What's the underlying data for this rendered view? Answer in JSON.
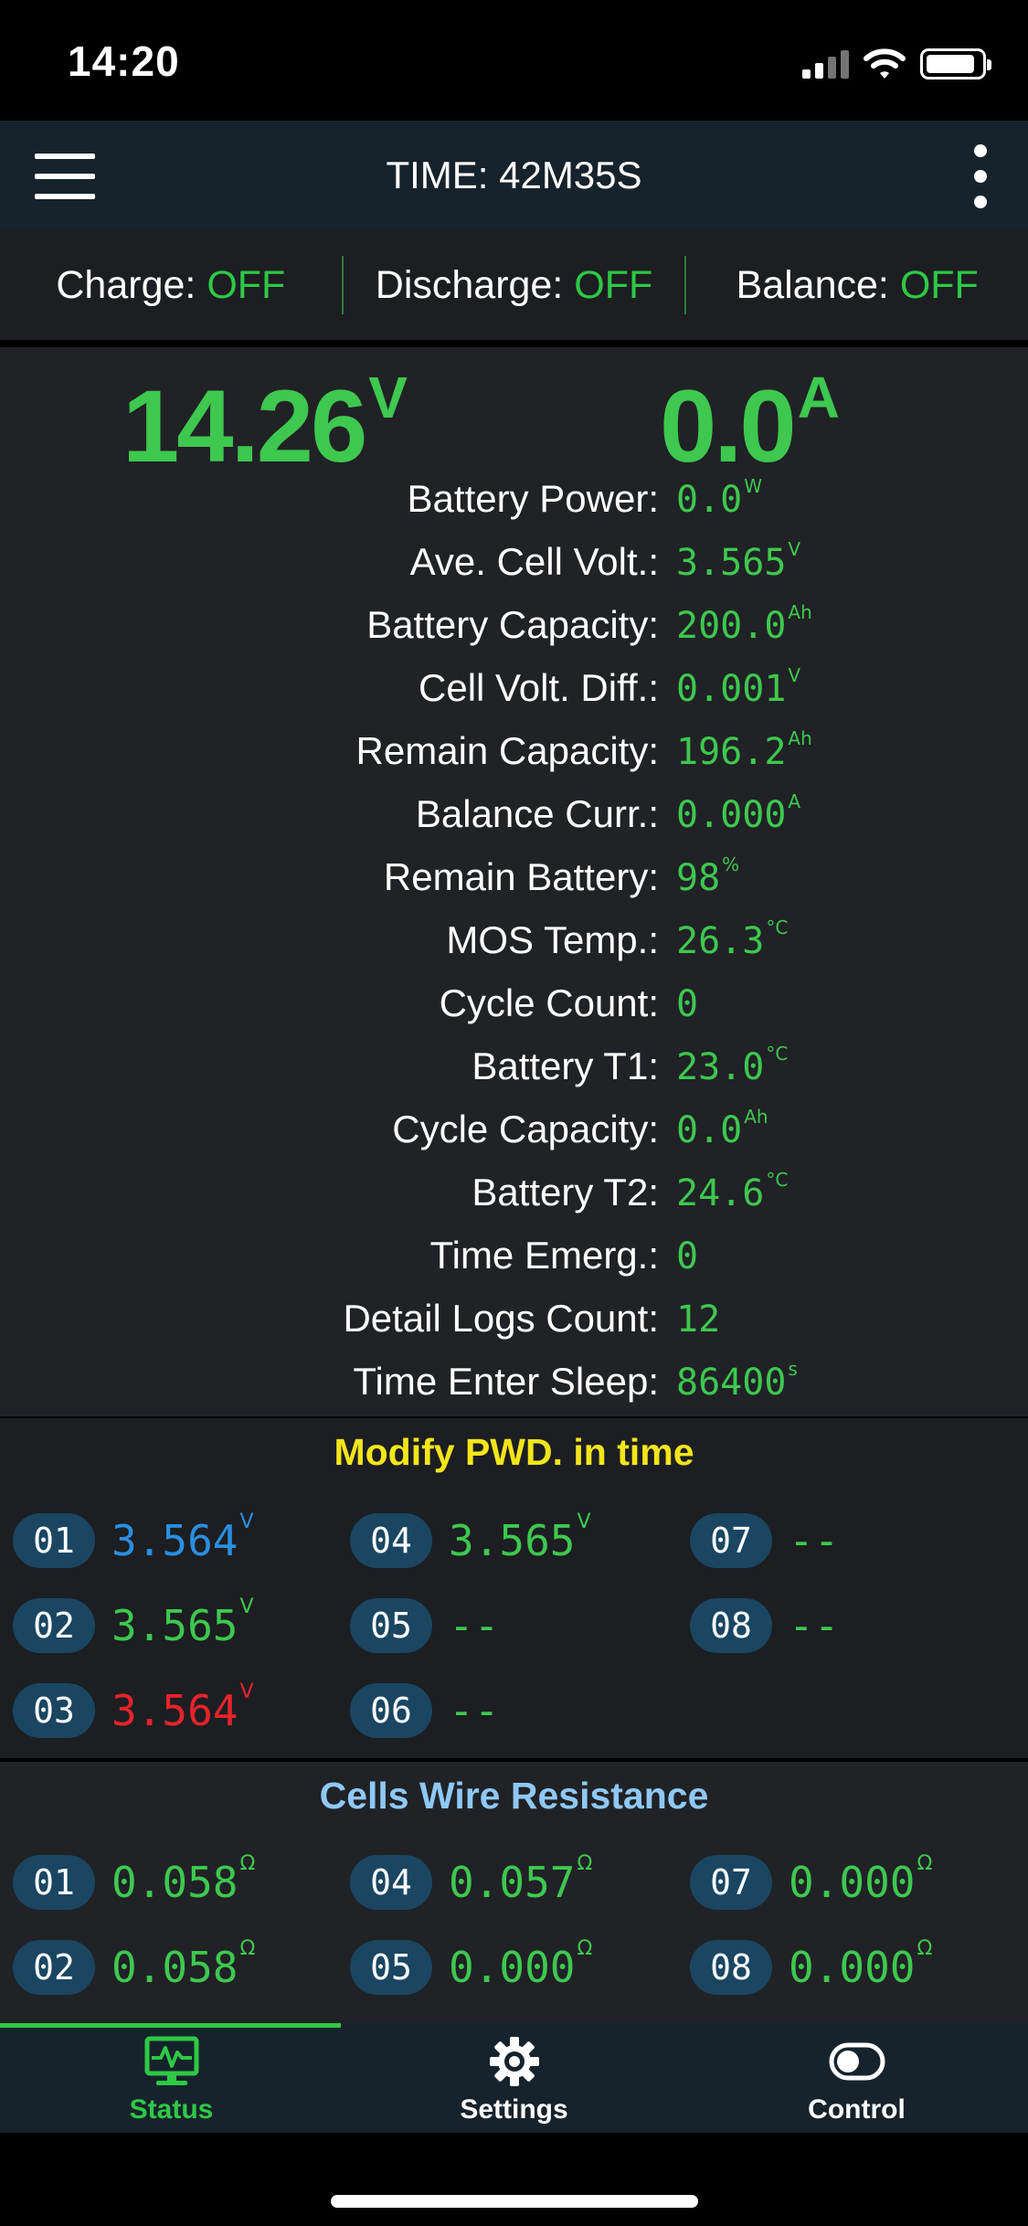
{
  "status_bar": {
    "time": "14:20",
    "icons": [
      "signal-icon",
      "wifi-icon",
      "battery-icon"
    ]
  },
  "header": {
    "title": "TIME: 42M35S",
    "icons": [
      "hamburger-menu-icon",
      "more-vertical-icon"
    ]
  },
  "switches": [
    {
      "label": "Charge: ",
      "value": "OFF"
    },
    {
      "label": "Discharge: ",
      "value": "OFF"
    },
    {
      "label": "Balance: ",
      "value": "OFF"
    }
  ],
  "main": {
    "voltage": {
      "value": "14.26",
      "unit": "V"
    },
    "current": {
      "value": "0.0",
      "unit": "A"
    },
    "readings": [
      {
        "label": "Battery Power:",
        "value": "0.0",
        "unit": "W"
      },
      {
        "label": "Ave. Cell Volt.:",
        "value": "3.565",
        "unit": "V"
      },
      {
        "label": "Battery Capacity:",
        "value": "200.0",
        "unit": "Ah"
      },
      {
        "label": "Cell Volt. Diff.:",
        "value": "0.001",
        "unit": "V"
      },
      {
        "label": "Remain Capacity:",
        "value": "196.2",
        "unit": "Ah"
      },
      {
        "label": "Balance Curr.:",
        "value": "0.000",
        "unit": "A"
      },
      {
        "label": "Remain Battery:",
        "value": "98",
        "unit": "%"
      },
      {
        "label": "MOS Temp.:",
        "value": "26.3",
        "unit": "°C"
      },
      {
        "label": "Cycle Count:",
        "value": "0",
        "unit": ""
      },
      {
        "label": "Battery T1:",
        "value": "23.0",
        "unit": "°C"
      },
      {
        "label": "Cycle Capacity:",
        "value": "0.0",
        "unit": "Ah"
      },
      {
        "label": "Battery T2:",
        "value": "24.6",
        "unit": "°C"
      },
      {
        "label": "Time Emerg.:",
        "value": "0",
        "unit": ""
      },
      {
        "label": "Detail Logs Count:",
        "value": "12",
        "unit": ""
      },
      {
        "label": "Time Enter Sleep:",
        "value": "86400",
        "unit": "s"
      }
    ]
  },
  "cell_voltages": {
    "title": "Modify PWD. in time",
    "cells": [
      {
        "id": "01",
        "value": "3.564",
        "unit": "V",
        "color": "#2a8fe0"
      },
      {
        "id": "02",
        "value": "3.565",
        "unit": "V",
        "color": "#3ec84f"
      },
      {
        "id": "03",
        "value": "3.564",
        "unit": "V",
        "color": "#e8232a"
      },
      {
        "id": "04",
        "value": "3.565",
        "unit": "V",
        "color": "#3ec84f"
      },
      {
        "id": "05",
        "value": "--",
        "unit": "",
        "color": "#3ec84f"
      },
      {
        "id": "06",
        "value": "--",
        "unit": "",
        "color": "#3ec84f"
      },
      {
        "id": "07",
        "value": "--",
        "unit": "",
        "color": "#3ec84f"
      },
      {
        "id": "08",
        "value": "--",
        "unit": "",
        "color": "#3ec84f"
      }
    ]
  },
  "wire_resistance": {
    "title": "Cells Wire Resistance",
    "cells": [
      {
        "id": "01",
        "value": "0.058",
        "unit": "Ω"
      },
      {
        "id": "02",
        "value": "0.058",
        "unit": "Ω"
      },
      {
        "id": "04",
        "value": "0.057",
        "unit": "Ω"
      },
      {
        "id": "05",
        "value": "0.000",
        "unit": "Ω"
      },
      {
        "id": "07",
        "value": "0.000",
        "unit": "Ω"
      },
      {
        "id": "08",
        "value": "0.000",
        "unit": "Ω"
      }
    ]
  },
  "tabs": [
    {
      "label": "Status",
      "icon": "monitor-pulse-icon",
      "active": true
    },
    {
      "label": "Settings",
      "icon": "gear-icon",
      "active": false
    },
    {
      "label": "Control",
      "icon": "toggle-icon",
      "active": false
    }
  ],
  "colors": {
    "accent_green": "#3ec84f",
    "title_yellow": "#f2e51b",
    "title_blue": "#8fc8f5",
    "badge_blue": "#1a4662",
    "header_bg": "#17232c",
    "panel_bg": "#202226"
  }
}
